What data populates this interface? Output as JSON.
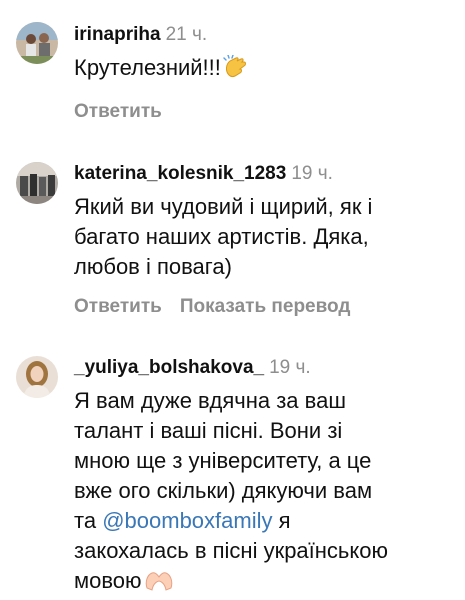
{
  "comments": [
    {
      "username": "irinapriha",
      "time": "21 ч.",
      "text": "Крутелезний!!!",
      "emoji": "clapping-hands-icon",
      "reply_label": "Ответить"
    },
    {
      "username": "katerina_kolesnik_1283",
      "time": "19 ч.",
      "text_lines": [
        "Який ви чудовий і щирий, як і",
        "багато наших артистів. Дяка,",
        "любов і повага)"
      ],
      "reply_label": "Ответить",
      "translate_label": "Показать перевод"
    },
    {
      "username": "_yuliya_bolshakova_",
      "time": "19 ч.",
      "text_lines": [
        "Я вам дуже вдячна за ваш",
        "талант і ваші пісні. Вони зі",
        "мною ще з університету, а це",
        "вже ого скільки) дякуючи вам"
      ],
      "line5_before": "та",
      "mention": "@boomboxfamily",
      "line5_after": "я",
      "text_lines_end": [
        "закохалась в пісні українською"
      ],
      "last_line": "мовою",
      "emoji": "heart-hands-icon"
    }
  ],
  "colors": {
    "secondary_text": "#8e8e8e",
    "mention": "#3a77b7",
    "primary_text": "#111111"
  }
}
